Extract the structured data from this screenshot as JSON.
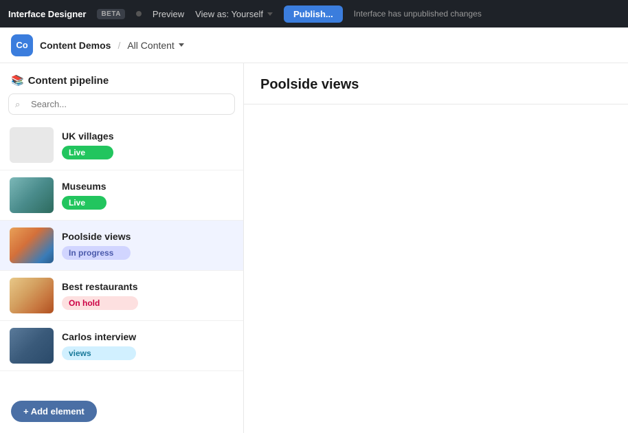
{
  "topnav": {
    "app_title": "Interface Designer",
    "beta_label": "BETA",
    "preview_label": "Preview",
    "view_as_label": "View as: Yourself",
    "publish_label": "Publish...",
    "unpublished_msg": "Interface has unpublished changes"
  },
  "breadcrumb": {
    "avatar_text": "Co",
    "org_name": "Content Demos",
    "nav_label": "All Content"
  },
  "sidebar": {
    "title": "Content pipeline",
    "title_icon": "📚",
    "search_placeholder": "Search..."
  },
  "content_items": [
    {
      "id": "uk-villages",
      "title": "UK villages",
      "status": "Live",
      "status_type": "live",
      "thumb_type": "blank"
    },
    {
      "id": "museums",
      "title": "Museums",
      "status": "Live",
      "status_type": "live",
      "thumb_type": "museums"
    },
    {
      "id": "poolside-views",
      "title": "Poolside views",
      "status": "In progress",
      "status_type": "in-progress",
      "thumb_type": "poolside",
      "active": true
    },
    {
      "id": "best-restaurants",
      "title": "Best restaurants",
      "status": "On hold",
      "status_type": "on-hold",
      "thumb_type": "restaurants"
    },
    {
      "id": "carlos-interview",
      "title": "Carlos interview",
      "status": "views",
      "status_type": "views",
      "thumb_type": "carlos"
    }
  ],
  "main_content": {
    "title": "Poolside views"
  },
  "add_element": {
    "label": "+ Add element"
  }
}
